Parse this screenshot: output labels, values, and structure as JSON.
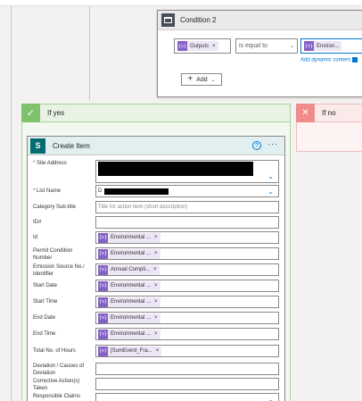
{
  "condition": {
    "title": "Condition 2",
    "left_token": "Outputs",
    "operator": "is equal to",
    "right_token": "Environ...",
    "dynamic_link": "Add dynamic content",
    "add_label": "Add"
  },
  "branches": {
    "yes_title": "If yes",
    "no_title": "If no"
  },
  "card": {
    "title": "Create Item",
    "help": "?",
    "more": "···"
  },
  "fields": {
    "site_address_label": "Site Address",
    "list_name_label": "List Name",
    "list_name_value": "D",
    "category_label": "Category Sub-title",
    "category_placeholder": "Title for action item (short description)",
    "idnum_label": "ID#",
    "id_label": "Id",
    "id_token": "Environmental ...",
    "permit_label": "Permit Condition Number",
    "permit_token": "Environmental ...",
    "emission_label": "Emission Source No./ Identifier",
    "emission_token": "Annual Compli...",
    "start_date_label": "Start Date",
    "start_date_token": "Environmental ...",
    "start_time_label": "Start Time",
    "start_time_token": "Environmental ...",
    "end_date_label": "End Date",
    "end_date_token": "Environmental ...",
    "end_time_label": "End Time",
    "end_time_token": "Environmental ...",
    "hours_label": "Total No. of Hours",
    "hours_token": "[SumEvent_Fra...",
    "deviation_label": "Deviation / Causes of Deviation",
    "corrective_label": "Corrective Action(s) Taken",
    "claims_label": "Responsible Claims"
  },
  "icons": {
    "token_glyph": "{x}",
    "remove_glyph": "×",
    "dropdown_glyph": "⌄",
    "check_glyph": "✓",
    "close_glyph": "✕",
    "sharepoint_glyph": "S"
  },
  "colors": {
    "accent": "#0078d4",
    "token_icon": "#8661c5",
    "yes_accent": "#7fc26e",
    "no_accent": "#f08b8b",
    "sharepoint": "#036c70"
  }
}
